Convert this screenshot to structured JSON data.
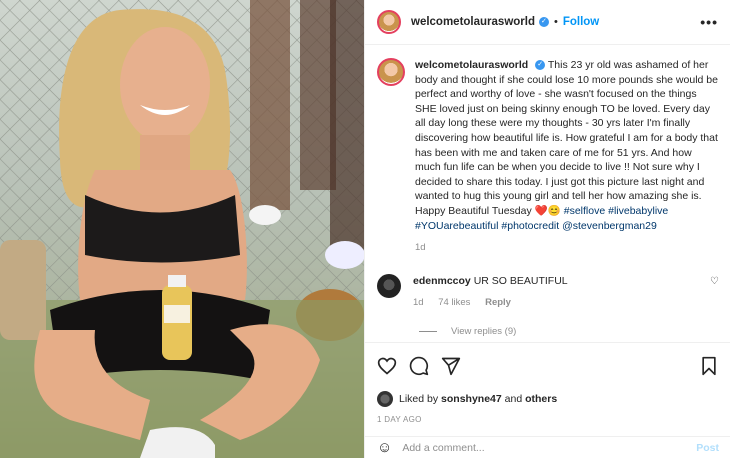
{
  "post": {
    "username": "welcometolaurasworld",
    "verified_mark": "✓",
    "separator": "•",
    "follow_label": "Follow",
    "more_label": "•••"
  },
  "caption": {
    "username": "welcometolaurasworld",
    "text": "This 23 yr old was ashamed of her body and thought if she could lose 10 more pounds she would be perfect and worthy of love - she wasn't focused on the things SHE loved just on being skinny enough TO be loved. Every day all day long these were my thoughts - 30 yrs later I'm finally discovering how beautiful life is. How grateful I am for a body that has been with me and taken care of me for 51 yrs. And how much fun life can be when you decide to live !! Not sure why I decided to share this today. I just got this picture last night and wanted to hug this young girl and tell her how amazing she is. Happy Beautiful Tuesday ",
    "emojis": "❤️😊",
    "tag1": "#selflove",
    "tag2": "#livebabylive",
    "tag3": "#YOUarebeautiful",
    "tag4": "#photocredit",
    "mention": "@stevenbergman29",
    "age": "1d"
  },
  "comment": {
    "username": "edenmccoy",
    "text": "UR SO BEAUTIFUL",
    "age": "1d",
    "likes": "74 likes",
    "reply_label": "Reply",
    "view_replies": "View replies (9)",
    "heart": "♡"
  },
  "likes": {
    "prefix": "Liked by",
    "user": "sonshyne47",
    "and": "and",
    "others": "others"
  },
  "date": "1 DAY AGO",
  "add_comment": {
    "smile": "☺",
    "placeholder": "Add a comment...",
    "post_label": "Post"
  },
  "colors": {
    "accent": "#0095f6",
    "verified": "#3897f0",
    "heart_red": "#ed4956"
  }
}
